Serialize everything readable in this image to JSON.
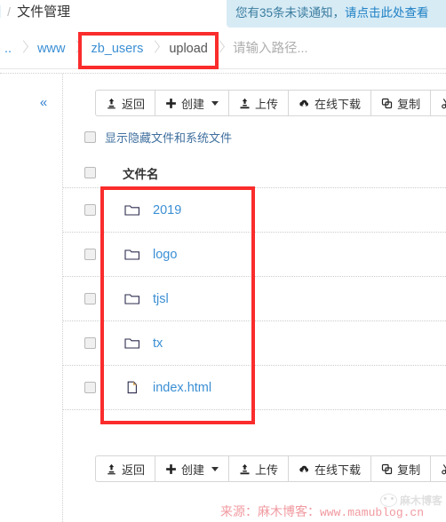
{
  "header": {
    "bracket": "]",
    "separator": "/",
    "title": "文件管理"
  },
  "notice": {
    "prefix": "您有35条未读通知，",
    "link_text": "请点击此处查看",
    "unread_count": "35",
    "bg_color": "#d7ebf5",
    "link_color": "#1d7fc4"
  },
  "breadcrumb": {
    "items": [
      {
        "label": "..",
        "current": false
      },
      {
        "label": "www",
        "current": false
      },
      {
        "label": "zb_users",
        "current": false
      },
      {
        "label": "upload",
        "current": true
      }
    ]
  },
  "path_field": {
    "value": "",
    "placeholder": "请输入路径..."
  },
  "sidebar": {
    "collapse_icon": "«"
  },
  "toolbar": {
    "buttons": [
      {
        "label": "返回",
        "icon": "upload-arrow-icon",
        "caret": false
      },
      {
        "label": "创建",
        "icon": "plus-icon",
        "caret": true
      },
      {
        "label": "上传",
        "icon": "upload-icon",
        "caret": false
      },
      {
        "label": "在线下载",
        "icon": "cloud-download-icon",
        "caret": false
      },
      {
        "label": "复制",
        "icon": "copy-icon",
        "caret": false
      },
      {
        "label": "",
        "icon": "scissors-icon",
        "caret": false
      }
    ]
  },
  "options": {
    "show_hidden_label": "显示隐藏文件和系统文件",
    "show_hidden_checked": false
  },
  "table": {
    "columns": [
      "文件名"
    ],
    "header_label": "文件名",
    "rows": [
      {
        "name": "2019",
        "type": "folder",
        "checked": false
      },
      {
        "name": "logo",
        "type": "folder",
        "checked": false
      },
      {
        "name": "tjsl",
        "type": "folder",
        "checked": false
      },
      {
        "name": "tx",
        "type": "folder",
        "checked": false
      },
      {
        "name": "index.html",
        "type": "file",
        "checked": false
      }
    ]
  },
  "annotations": {
    "color": "#fa2c2c",
    "boxes": [
      "breadcrumb-highlight",
      "file-list-highlight"
    ]
  },
  "watermark": {
    "source_label": "来源：麻木博客：",
    "url": "www.mamublog.cn",
    "logo_text": "麻木博客",
    "color": "#f09aa0"
  }
}
